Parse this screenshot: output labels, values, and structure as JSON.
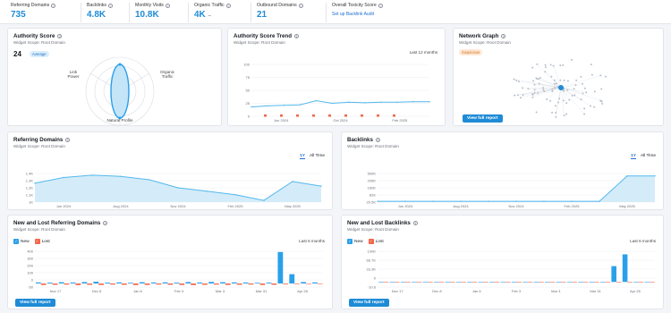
{
  "metrics": [
    {
      "label": "Referring Domains",
      "value": "735"
    },
    {
      "label": "Backlinks",
      "value": "4.8K"
    },
    {
      "label": "Monthly Visits",
      "value": "10.8K"
    },
    {
      "label": "Organic Traffic",
      "value": "4K"
    },
    {
      "label": "Outbound Domains",
      "value": "21"
    },
    {
      "label": "Overall Toxicity Score",
      "value": "",
      "link": "Set up Backlink Audit"
    }
  ],
  "authority_score": {
    "title": "Authority Score",
    "scope": "Widget Scope: Root Domain",
    "score": "24",
    "badge": "Average",
    "radar_labels": {
      "left": "Link Power",
      "right": "Organic Traffic",
      "bottom": "Natural Profile"
    }
  },
  "authority_trend": {
    "title": "Authority Score Trend",
    "scope": "Widget Scope: Root Domain",
    "period": "Last 12 months",
    "chart_data": {
      "type": "line",
      "ylim": [
        0,
        100
      ],
      "yticks": [
        "100",
        "75",
        "50",
        "25",
        "0"
      ],
      "xticks": [
        "Jun 2024",
        "Oct 2024",
        "Feb 2025"
      ],
      "values": [
        18,
        20,
        21,
        22,
        30,
        25,
        27,
        26,
        27,
        27,
        28,
        28
      ]
    }
  },
  "network_graph": {
    "title": "Network Graph",
    "scope": "Widget Scope: Root Domain",
    "badge": "Suspicious",
    "button": "View full report"
  },
  "referring_domains": {
    "title": "Referring Domains",
    "scope": "Widget Scope: Root Domain",
    "toggle": [
      "1Y",
      "All Time"
    ],
    "chart_data": {
      "type": "area",
      "ylim": [
        0.95,
        1.45
      ],
      "yticks": [
        "1.4K",
        "1.3K",
        "1.2K",
        "1.1K",
        "1K"
      ],
      "xticks": [
        "Jun 2024",
        "Aug 2024",
        "Nov 2024",
        "Feb 2025",
        "May 2025"
      ],
      "values": [
        1.28,
        1.38,
        1.42,
        1.4,
        1.34,
        1.2,
        1.14,
        1.08,
        0.98,
        1.31,
        1.23
      ]
    }
  },
  "backlinks": {
    "title": "Backlinks",
    "scope": "Widget Scope: Root Domain",
    "toggle": [
      "1Y",
      "All Time"
    ],
    "chart_data": {
      "type": "area",
      "ylim": [
        0,
        700
      ],
      "yticks": [
        "590K",
        "295K",
        "160K",
        "82K",
        "20.5K"
      ],
      "xticks": [
        "Jun 2024",
        "Aug 2024",
        "Nov 2024",
        "Feb 2025",
        "May 2025"
      ],
      "values": [
        20,
        20,
        20,
        20,
        20,
        20,
        20,
        20,
        20,
        640,
        640
      ]
    }
  },
  "new_lost_rd": {
    "title": "New and Lost Referring Domains",
    "scope": "Widget Scope: Root Domain",
    "period": "Last 6 months",
    "legend": [
      "New",
      "Lost"
    ],
    "button": "View full report",
    "chart_data": {
      "type": "bar",
      "ylim": [
        -50,
        450
      ],
      "yticks": [
        "400",
        "300",
        "200",
        "100",
        "0",
        "-50"
      ],
      "xticks": [
        "Nov 17",
        "Dec 8",
        "Jan 6",
        "Feb 3",
        "Mar 3",
        "Mar 31",
        "Apr 28"
      ],
      "new": [
        15,
        12,
        18,
        14,
        20,
        25,
        12,
        15,
        10,
        18,
        14,
        16,
        12,
        20,
        14,
        22,
        18,
        15,
        14,
        10,
        12,
        440,
        130,
        20,
        15
      ],
      "lost": [
        -20,
        -18,
        -15,
        -22,
        -18,
        -20,
        -15,
        -18,
        -22,
        -20,
        -15,
        -18,
        -20,
        -22,
        -18,
        -15,
        -20,
        -18,
        -15,
        -20,
        -18,
        -10,
        -8,
        -5,
        -5
      ]
    }
  },
  "new_lost_bl": {
    "title": "New and Lost Backlinks",
    "scope": "Widget Scope: Root Domain",
    "period": "Last 6 months",
    "legend": [
      "New",
      "Lost"
    ],
    "button": "View full report",
    "chart_data": {
      "type": "bar",
      "ylim": [
        -20,
        120
      ],
      "yticks": [
        "100K",
        "66.7K",
        "33.3K",
        "0",
        "-10.6"
      ],
      "xticks": [
        "Nov 17",
        "Dec 8",
        "Jan 6",
        "Feb 3",
        "Mar 3",
        "Mar 31",
        "Apr 28"
      ],
      "new": [
        0.3,
        0.2,
        0.3,
        0.2,
        0.3,
        0.2,
        0.3,
        0.2,
        0.3,
        0.2,
        0.3,
        0.2,
        0.3,
        0.2,
        0.3,
        0.2,
        0.3,
        0.2,
        0.3,
        0.3,
        0.4,
        62,
        108,
        1,
        0.5
      ],
      "lost": [
        -0.5,
        -0.5,
        -0.5,
        -0.5,
        -0.5,
        -0.5,
        -0.5,
        -0.5,
        -0.5,
        -0.5,
        -0.5,
        -0.5,
        -0.5,
        -0.5,
        -0.5,
        -0.5,
        -0.5,
        -0.5,
        -0.5,
        -0.5,
        -0.5,
        -0.5,
        -0.5,
        -0.5,
        -0.5
      ]
    }
  },
  "colors": {
    "accent": "#1f8bd6",
    "line": "#52b8ee",
    "area": "#c9e7f8",
    "new": "#2aa0ea",
    "lost": "#f2654a",
    "grid": "#eceef2"
  }
}
